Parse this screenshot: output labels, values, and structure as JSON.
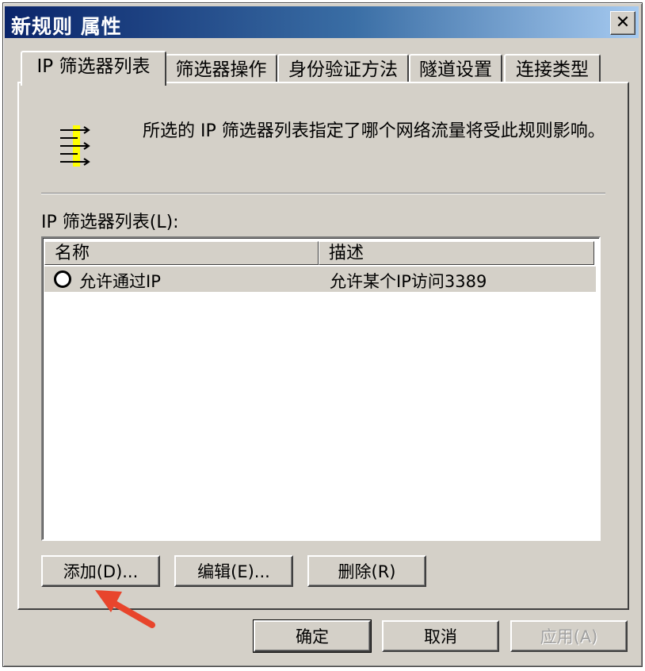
{
  "window": {
    "title": "新规则 属性",
    "close_glyph": "✕"
  },
  "tabs": [
    {
      "label": "IP 筛选器列表",
      "active": true
    },
    {
      "label": "筛选器操作"
    },
    {
      "label": "身份验证方法"
    },
    {
      "label": "隧道设置"
    },
    {
      "label": "连接类型"
    }
  ],
  "info": {
    "icon": "filter-list-icon",
    "text": "所选的 IP 筛选器列表指定了哪个网络流量将受此规则影响。"
  },
  "list": {
    "label": "IP 筛选器列表(L):",
    "columns": [
      "名称",
      "描述"
    ],
    "rows": [
      {
        "name": "允许通过IP",
        "description": "允许某个IP访问3389",
        "selected": false
      }
    ]
  },
  "actions": {
    "add": "添加(D)...",
    "edit": "编辑(E)...",
    "delete": "删除(R)"
  },
  "footer": {
    "ok": "确定",
    "cancel": "取消",
    "apply": "应用(A)"
  },
  "annotation": {
    "color": "#e8452c"
  }
}
